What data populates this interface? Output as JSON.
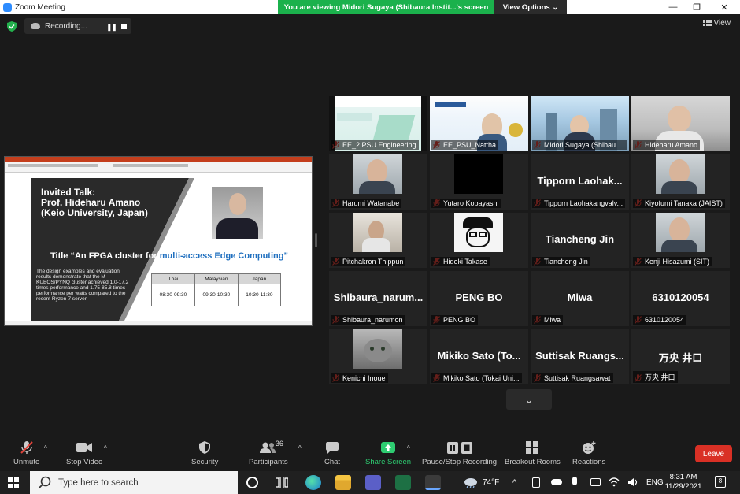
{
  "window": {
    "title": "Zoom Meeting",
    "banner": "You are viewing Midori Sugaya (Shibaura Instit...'s screen",
    "view_options": "View Options ⌄",
    "minimize": "—",
    "restore": "❐",
    "close": "✕"
  },
  "meeting": {
    "recording_label": "Recording...",
    "pause_glyph": "❚❚",
    "view_label": "View"
  },
  "shared_slide": {
    "title_line1": "Invited Talk:",
    "title_line2": "Prof. Hideharu Amano",
    "title_line3": "(Keio University, Japan)",
    "talk_title_prefix": "Title “An FPGA cluster for ",
    "talk_title_highlight": "multi-access Edge Computing”",
    "description": "The design examples and evaluation results demonstrate that the M-KUBOS/PYNQ cluster achieved 1.0-17.2 times performance and 1.75-85.8 times performance per watts compared to the recent Ryzen-7 server.",
    "schedule_headers": [
      "Thai",
      "Malaysian",
      "Japan"
    ],
    "schedule_times": [
      "08:30-09:30",
      "09:30-10:30",
      "10:30-11:30"
    ]
  },
  "participants": [
    {
      "label": "EE_2 PSU Engineering",
      "kind": "video",
      "video": "slide1"
    },
    {
      "label": "EE_PSU_Nattha",
      "kind": "video",
      "video": "slide2"
    },
    {
      "label": "Midori Sugaya (Shibaura I...",
      "kind": "video",
      "video": "building",
      "active": true
    },
    {
      "label": "Hideharu Amano",
      "kind": "video",
      "video": "office"
    },
    {
      "label": "Harumi Watanabe",
      "kind": "video",
      "video": "person"
    },
    {
      "label": "Yutaro Kobayashi",
      "kind": "video",
      "video": "black"
    },
    {
      "label": "Tipporn Laohakangvalv...",
      "kind": "name",
      "big": "Tipporn  Laohak..."
    },
    {
      "label": "Kiyofumi Tanaka (JAIST)",
      "kind": "video",
      "video": "person"
    },
    {
      "label": "Pitchakron Thippun",
      "kind": "video",
      "video": "room"
    },
    {
      "label": "Hideki Takase",
      "kind": "video",
      "video": "sketch"
    },
    {
      "label": "Tiancheng Jin",
      "kind": "name",
      "big": "Tiancheng Jin"
    },
    {
      "label": "Kenji Hisazumi (SIT)",
      "kind": "video",
      "video": "person"
    },
    {
      "label": "Shibaura_narumon",
      "kind": "name",
      "big": "Shibaura_narum..."
    },
    {
      "label": "PENG BO",
      "kind": "name",
      "big": "PENG BO"
    },
    {
      "label": "Miwa",
      "kind": "name",
      "big": "Miwa"
    },
    {
      "label": "6310120054",
      "kind": "name",
      "big": "6310120054"
    },
    {
      "label": "Kenichi Inoue",
      "kind": "video",
      "video": "cat"
    },
    {
      "label": "Mikiko Sato (Tokai Uni...",
      "kind": "name",
      "big": "Mikiko Sato (To..."
    },
    {
      "label": "Suttisak Ruangsawat",
      "kind": "name",
      "big": "Suttisak  Ruangs..."
    },
    {
      "label": "万央 井口",
      "kind": "name",
      "big": "万央 井口"
    }
  ],
  "gallery_scroll_glyph": "⌄",
  "toolbar": {
    "unmute": "Unmute",
    "stop_video": "Stop Video",
    "security": "Security",
    "participants": "Participants",
    "participants_count": "36",
    "chat": "Chat",
    "share_screen": "Share Screen",
    "pause_stop_recording": "Pause/Stop Recording",
    "breakout_rooms": "Breakout Rooms",
    "reactions": "Reactions",
    "leave": "Leave",
    "caret": "^"
  },
  "taskbar": {
    "search_placeholder": "Type here to search",
    "weather": "74°F",
    "language": "ENG",
    "time": "8:31 AM",
    "date": "11/29/2021",
    "notifications": "8"
  },
  "colors": {
    "banner_green": "#1bb14c",
    "active_outline": "#b9d94e",
    "leave_red": "#d93025",
    "share_green": "#2ecc71",
    "muted_red": "#e0433a"
  }
}
